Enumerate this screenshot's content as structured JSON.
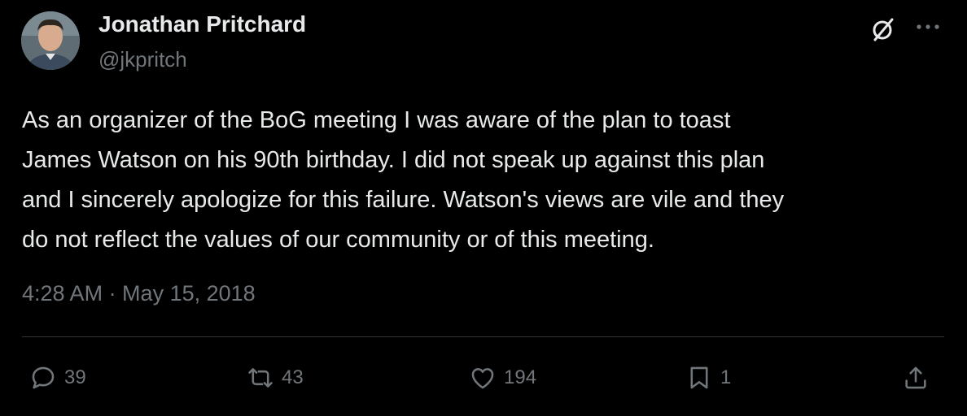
{
  "author": {
    "name": "Jonathan Pritchard",
    "handle": "@jkpritch"
  },
  "tweet": {
    "text": "As an organizer of the BoG meeting I was aware of the plan to toast\nJames Watson on his 90th birthday. I did not speak up against this plan\nand I sincerely apologize for this failure. Watson's views are vile and they\ndo not reflect the values of our community or of this meeting.",
    "timestamp": "4:28 AM · May 15, 2018"
  },
  "actions": {
    "replies": "39",
    "reposts": "43",
    "likes": "194",
    "bookmarks": "1"
  },
  "icons": {
    "header": [
      "grok-icon",
      "more-icon"
    ],
    "actions": [
      "reply-icon",
      "repost-icon",
      "like-icon",
      "bookmark-icon",
      "share-icon"
    ]
  },
  "colors": {
    "background": "#000000",
    "text": "#e7e9ea",
    "secondary": "#71767b",
    "divider": "#2f3336"
  }
}
